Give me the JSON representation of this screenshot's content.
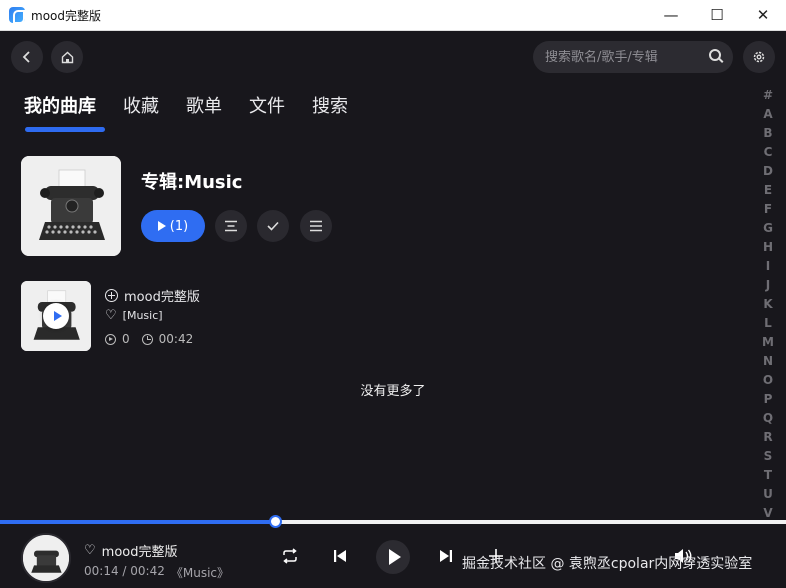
{
  "window": {
    "title": "mood完整版",
    "minimize": "—",
    "maximize": "☐",
    "close": "✕"
  },
  "topbar": {
    "search_placeholder": "搜索歌名/歌手/专辑"
  },
  "tabs": [
    {
      "label": "我的曲库",
      "active": true
    },
    {
      "label": "收藏",
      "active": false
    },
    {
      "label": "歌单",
      "active": false
    },
    {
      "label": "文件",
      "active": false
    },
    {
      "label": "搜索",
      "active": false
    }
  ],
  "alphabet": [
    "#",
    "A",
    "B",
    "C",
    "D",
    "E",
    "F",
    "G",
    "H",
    "I",
    "J",
    "K",
    "L",
    "M",
    "N",
    "O",
    "P",
    "Q",
    "R",
    "S",
    "T",
    "U",
    "V"
  ],
  "album": {
    "title": "专辑:Music",
    "play_all_label": "(1)"
  },
  "songs": [
    {
      "name": "mood完整版",
      "album": "[Music]",
      "plays": "0",
      "duration": "00:42"
    }
  ],
  "no_more": "没有更多了",
  "player": {
    "song": "mood完整版",
    "current_time": "00:14",
    "total_time": "00:42",
    "album": "《Music》",
    "progress": 0.35
  },
  "watermark": "掘金技术社区 @ 袁煦丞cpolar内网穿透实验室",
  "colors": {
    "accent": "#2f6df2",
    "background": "#18171c",
    "button_bg": "#2a292f"
  }
}
